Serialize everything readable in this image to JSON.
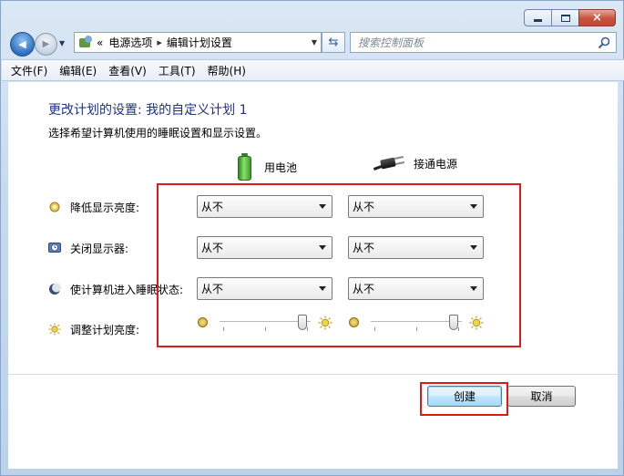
{
  "window": {
    "controls": {
      "minimize": "minimize",
      "maximize": "maximize",
      "close": "×"
    }
  },
  "nav": {
    "back_glyph": "◀",
    "forward_glyph": "▶",
    "breadcrumb_overflow": "«",
    "breadcrumb": [
      "电源选项",
      "编辑计划设置"
    ],
    "search_placeholder": "搜索控制面板"
  },
  "menu": [
    "文件(F)",
    "编辑(E)",
    "查看(V)",
    "工具(T)",
    "帮助(H)"
  ],
  "page": {
    "title": "更改计划的设置: 我的自定义计划 1",
    "subtitle": "选择希望计算机使用的睡眠设置和显示设置。",
    "columns": {
      "battery": "用电池",
      "plugged_in": "接通电源"
    }
  },
  "settings": [
    {
      "label": "降低显示亮度:",
      "icon": "dim-display-icon",
      "battery": "从不",
      "plugged_in": "从不"
    },
    {
      "label": "关闭显示器:",
      "icon": "display-off-icon",
      "battery": "从不",
      "plugged_in": "从不"
    },
    {
      "label": "使计算机进入睡眠状态:",
      "icon": "sleep-icon",
      "battery": "从不",
      "plugged_in": "从不"
    }
  ],
  "brightness": {
    "label": "调整计划亮度:",
    "battery_level": 0.95,
    "plugged_in_level": 0.95
  },
  "buttons": {
    "create": "创建",
    "cancel": "取消"
  },
  "colors": {
    "highlight_box": "#e01919",
    "title": "#1e3287"
  }
}
